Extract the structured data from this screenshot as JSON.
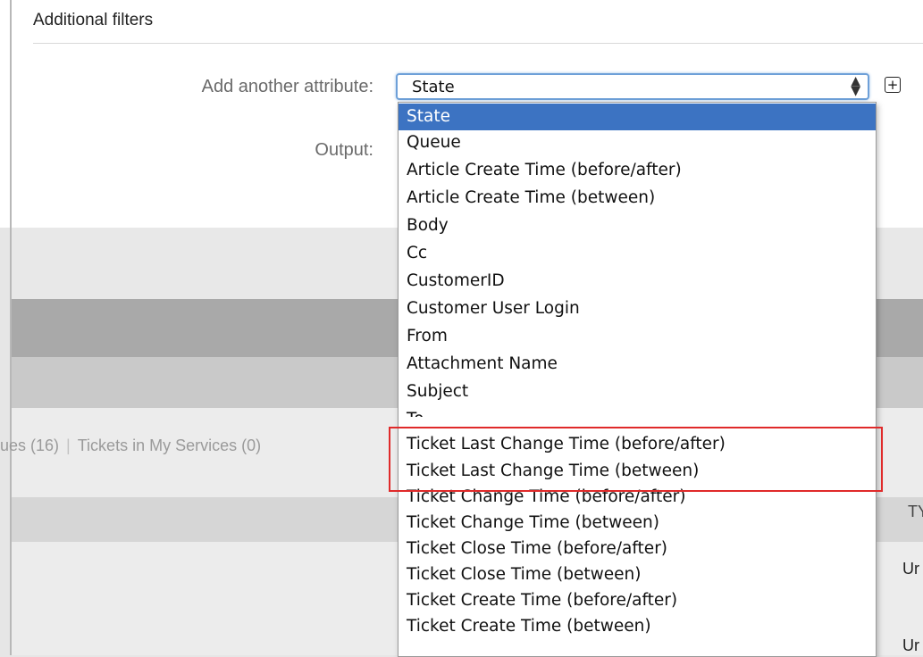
{
  "section": {
    "title": "Additional filters"
  },
  "form": {
    "add_attribute_label": "Add another attribute:",
    "output_label": "Output:",
    "selected_value": "State",
    "arrows": "⌃⌄",
    "add_button_glyph": "+"
  },
  "tabs": {
    "queues": "ues (16)",
    "separator": "|",
    "services": "Tickets in My Services (0)"
  },
  "table": {
    "col_header_partial": "TY",
    "row1_partial": "Ur",
    "row2_partial": "Ur"
  },
  "dropdown": {
    "options": [
      "State",
      "Queue",
      "Article Create Time (before/after)",
      "Article Create Time (between)",
      "Body",
      "Cc",
      "CustomerID",
      "Customer User Login",
      "From",
      "Attachment Name",
      "Subject",
      "To",
      "Ticket Last Change Time (before/after)",
      "Ticket Last Change Time (between)",
      "Ticket Change Time (before/after)",
      "Ticket Change Time (between)",
      "Ticket Close Time (before/after)",
      "Ticket Close Time (between)",
      "Ticket Create Time (before/after)",
      "Ticket Create Time (between)"
    ],
    "selected_index": 0
  },
  "colors": {
    "selection": "#3c73c2",
    "highlight": "#e02a2a",
    "focus_ring": "#6ea0d8"
  }
}
